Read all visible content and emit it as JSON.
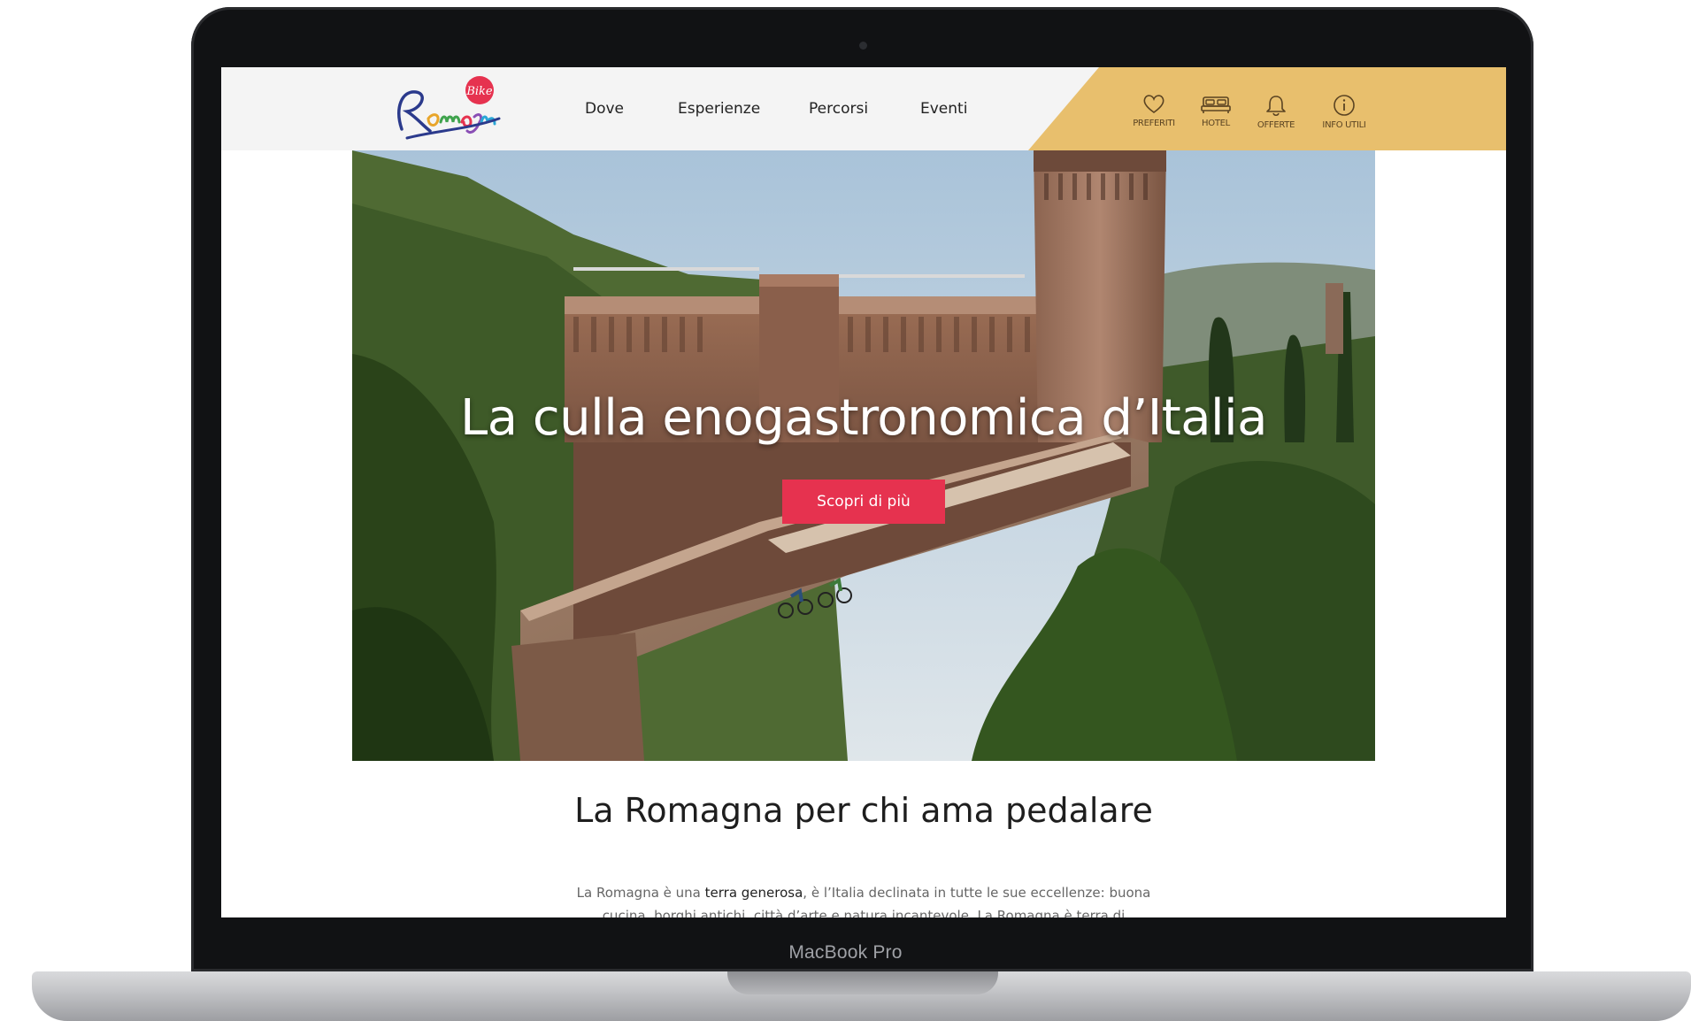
{
  "device": {
    "label": "MacBook Pro"
  },
  "header": {
    "logo_alt": "Romagna Bike",
    "nav": [
      {
        "label": "Dove"
      },
      {
        "label": "Esperienze"
      },
      {
        "label": "Percorsi"
      },
      {
        "label": "Eventi"
      }
    ],
    "utilities": [
      {
        "label": "PREFERITI",
        "icon": "heart-icon"
      },
      {
        "label": "HOTEL",
        "icon": "bed-icon"
      },
      {
        "label": "OFFERTE",
        "icon": "bell-icon"
      },
      {
        "label": "INFO UTILI",
        "icon": "info-icon"
      }
    ],
    "accent_color": "#e8bf6d"
  },
  "hero": {
    "title": "La culla enogastronomica d’Italia",
    "cta_label": "Scopri di più",
    "cta_color": "#e6324f"
  },
  "intro": {
    "title": "La Romagna per chi ama pedalare",
    "text_before": "La Romagna è una ",
    "text_bold": "terra generosa",
    "text_after": ", è l’Italia declinata in tutte le sue eccellenze: buona cucina, borghi antichi, città d’arte e natura incantevole. La Romagna è terra di"
  }
}
